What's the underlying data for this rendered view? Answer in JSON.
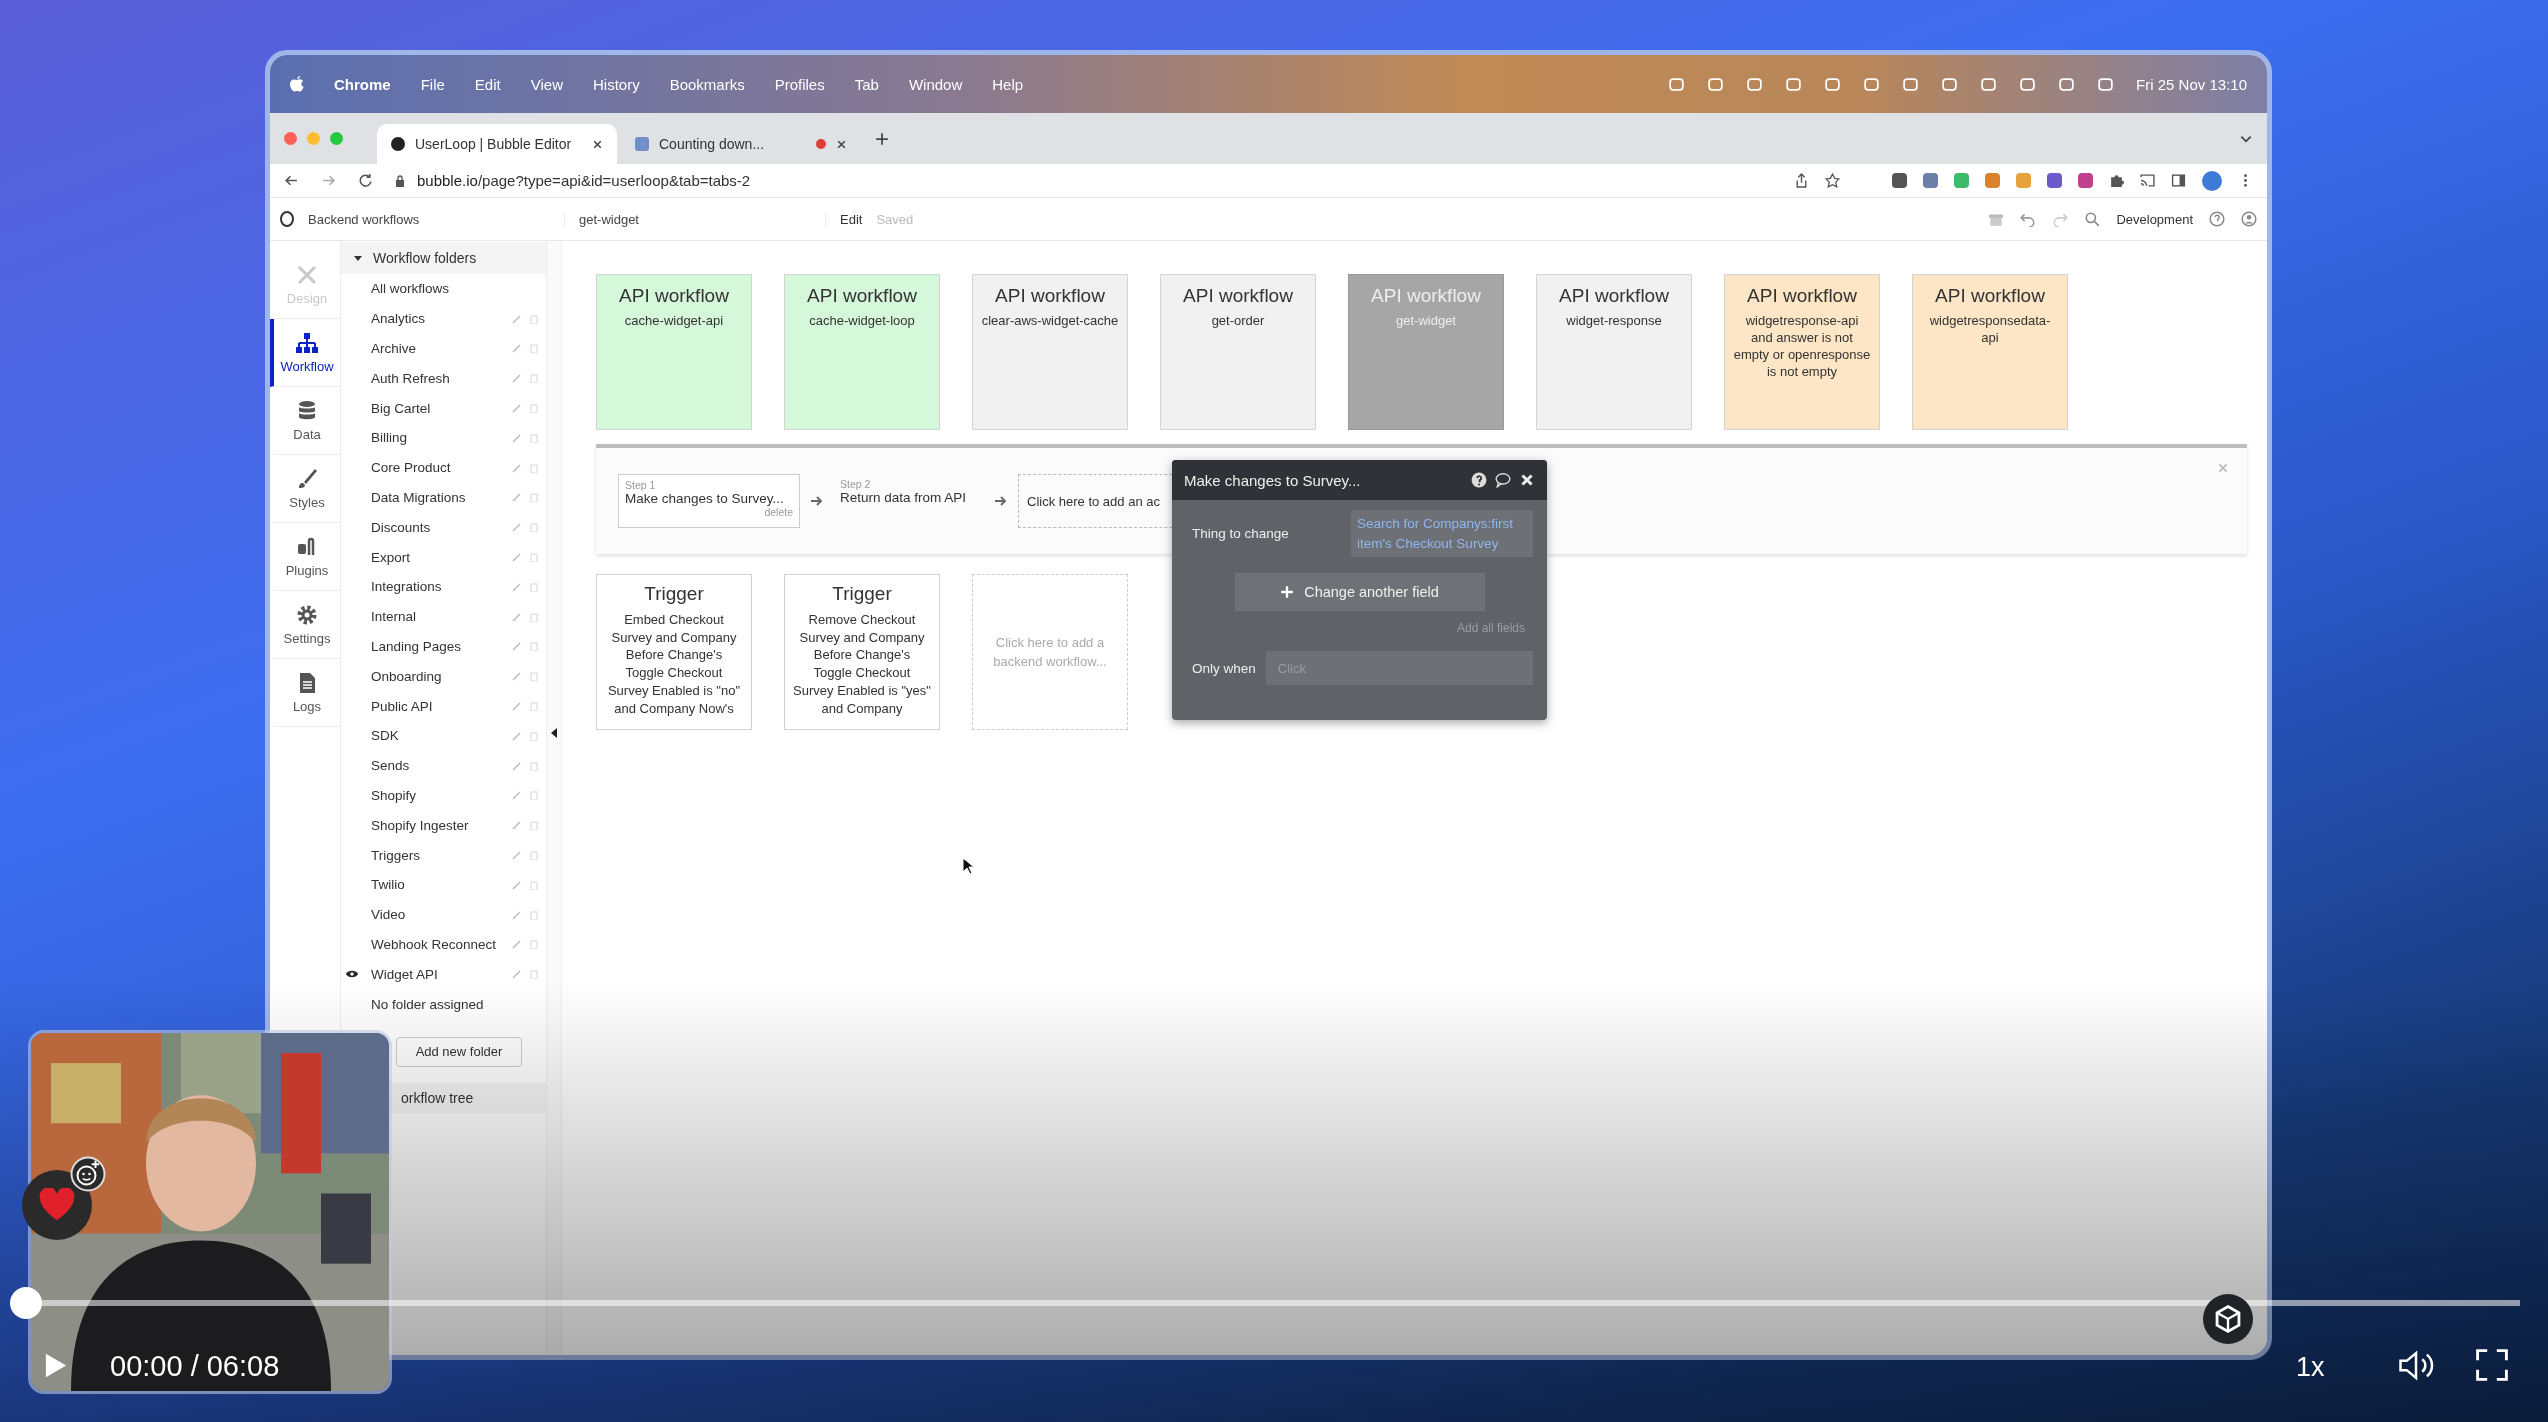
{
  "menubar": {
    "app": "Chrome",
    "items": [
      "File",
      "Edit",
      "View",
      "History",
      "Bookmarks",
      "Profiles",
      "Tab",
      "Window",
      "Help"
    ],
    "clock": "Fri 25 Nov  13:10"
  },
  "browser_tabs": [
    {
      "title": "UserLoop | Bubble Editor",
      "selected": true,
      "recording": false
    },
    {
      "title": "Counting down...",
      "selected": false,
      "recording": true
    }
  ],
  "url": {
    "host": "bubble.io",
    "path": "/page?type=api&id=userloop&tab=tabs-2"
  },
  "editor_toolbar": {
    "page": "Backend workflows",
    "workflow": "get-widget",
    "edit": "Edit",
    "saved": "Saved",
    "environment": "Development"
  },
  "rail": [
    {
      "label": "Design",
      "kind": "design",
      "selected": false,
      "disabled": true
    },
    {
      "label": "Workflow",
      "kind": "workflow",
      "selected": true,
      "disabled": false
    },
    {
      "label": "Data",
      "kind": "data",
      "selected": false,
      "disabled": false
    },
    {
      "label": "Styles",
      "kind": "styles",
      "selected": false,
      "disabled": false
    },
    {
      "label": "Plugins",
      "kind": "plugins",
      "selected": false,
      "disabled": false
    },
    {
      "label": "Settings",
      "kind": "settings",
      "selected": false,
      "disabled": false
    },
    {
      "label": "Logs",
      "kind": "logs",
      "selected": false,
      "disabled": false
    }
  ],
  "folders": {
    "title": "Workflow folders",
    "expanded": true,
    "items": [
      {
        "name": "All workflows",
        "kind": "all"
      },
      {
        "name": "Analytics",
        "kind": "folder",
        "watched": false
      },
      {
        "name": "Archive",
        "kind": "folder",
        "watched": false
      },
      {
        "name": "Auth Refresh",
        "kind": "folder",
        "watched": false
      },
      {
        "name": "Big Cartel",
        "kind": "folder",
        "watched": false
      },
      {
        "name": "Billing",
        "kind": "folder",
        "watched": false
      },
      {
        "name": "Core Product",
        "kind": "folder",
        "watched": false
      },
      {
        "name": "Data Migrations",
        "kind": "folder",
        "watched": false
      },
      {
        "name": "Discounts",
        "kind": "folder",
        "watched": false
      },
      {
        "name": "Export",
        "kind": "folder",
        "watched": false
      },
      {
        "name": "Integrations",
        "kind": "folder",
        "watched": false
      },
      {
        "name": "Internal",
        "kind": "folder",
        "watched": false
      },
      {
        "name": "Landing Pages",
        "kind": "folder",
        "watched": false
      },
      {
        "name": "Onboarding",
        "kind": "folder",
        "watched": false
      },
      {
        "name": "Public API",
        "kind": "folder",
        "watched": false
      },
      {
        "name": "SDK",
        "kind": "folder",
        "watched": false
      },
      {
        "name": "Sends",
        "kind": "folder",
        "watched": false
      },
      {
        "name": "Shopify",
        "kind": "folder",
        "watched": false
      },
      {
        "name": "Shopify Ingester",
        "kind": "folder",
        "watched": false
      },
      {
        "name": "Triggers",
        "kind": "folder",
        "watched": false
      },
      {
        "name": "Twilio",
        "kind": "folder",
        "watched": false
      },
      {
        "name": "Video",
        "kind": "folder",
        "watched": false
      },
      {
        "name": "Webhook Reconnect",
        "kind": "folder",
        "watched": false
      },
      {
        "name": "Widget API",
        "kind": "folder",
        "watched": true
      },
      {
        "name": "No folder assigned",
        "kind": "none"
      }
    ],
    "add_button": "Add new folder"
  },
  "workflow_tree": "orkflow tree",
  "cards": [
    {
      "title": "API workflow",
      "name": "cache-widget-api",
      "color": "#d6f8da",
      "selected": false
    },
    {
      "title": "API workflow",
      "name": "cache-widget-loop",
      "color": "#d6f8da",
      "selected": false
    },
    {
      "title": "API workflow",
      "name": "clear-aws-widget-cache",
      "color": "#f1f1f1",
      "selected": false
    },
    {
      "title": "API workflow",
      "name": "get-order",
      "color": "#f1f1f1",
      "selected": false
    },
    {
      "title": "API workflow",
      "name": "get-widget",
      "color": "#a6a6a6",
      "selected": true
    },
    {
      "title": "API workflow",
      "name": "widget-response",
      "color": "#f1f1f1",
      "selected": false
    },
    {
      "title": "API workflow",
      "name": "widgetresponse-api and answer is not empty or openresponse is not empty",
      "color": "#fde6c6",
      "selected": false
    },
    {
      "title": "API workflow",
      "name": "widgetresponsedata-api",
      "color": "#fde6c6",
      "selected": false
    }
  ],
  "steps": [
    {
      "label": "Step 1",
      "title": "Make changes to Survey...",
      "action": "delete",
      "selected": true
    },
    {
      "label": "Step 2",
      "title": "Return data from API",
      "selected": false
    }
  ],
  "add_action": "Click here to add an ac",
  "triggers": [
    {
      "title": "Trigger",
      "text": "Embed Checkout Survey and Company Before Change's Toggle Checkout Survey Enabled is \"no\" and Company Now's"
    },
    {
      "title": "Trigger",
      "text": "Remove Checkout Survey and Company Before Change's Toggle Checkout Survey Enabled is \"yes\" and Company"
    }
  ],
  "add_workflow": "Click here to add a backend workflow...",
  "popup": {
    "title": "Make changes to Survey...",
    "field_label": "Thing to change",
    "field_value": "Search for Companys:first item's Checkout Survey",
    "button": "Change another field",
    "add_all": "Add all fields",
    "condition_label": "Only when",
    "condition_placeholder": "Click"
  },
  "player": {
    "time": "00:00 / 06:08",
    "speed": "1x",
    "progress": {
      "level": 0
    }
  }
}
